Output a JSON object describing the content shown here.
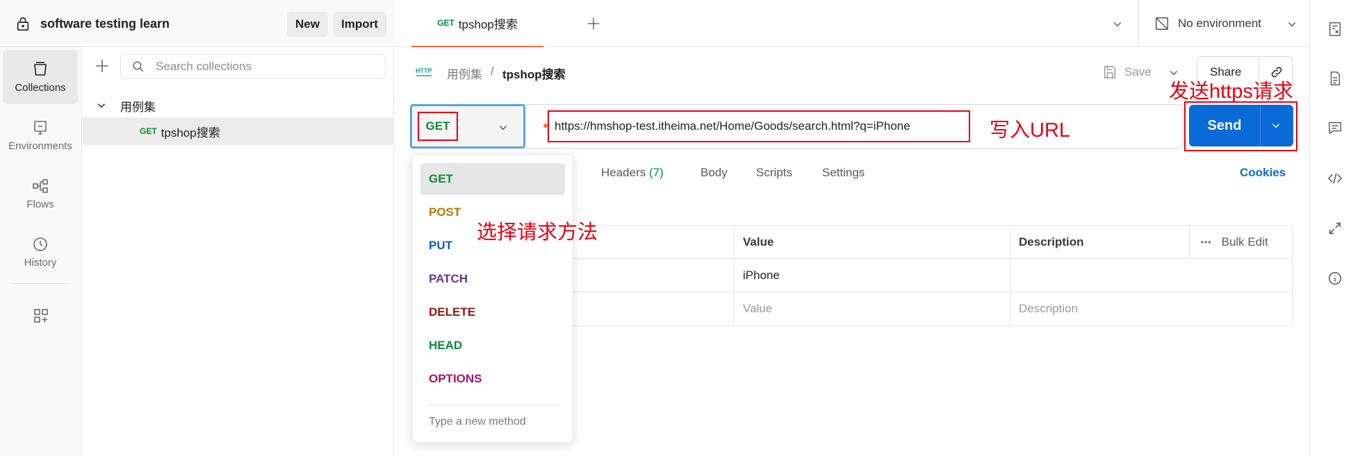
{
  "workspace": {
    "title": "software testing learn",
    "new_label": "New",
    "import_label": "Import"
  },
  "rail": {
    "items": [
      {
        "label": "Collections",
        "icon": "collections-icon",
        "active": true
      },
      {
        "label": "Environments",
        "icon": "environments-icon"
      },
      {
        "label": "Flows",
        "icon": "flows-icon"
      },
      {
        "label": "History",
        "icon": "history-icon"
      }
    ]
  },
  "sidebar": {
    "search_placeholder": "Search collections",
    "folder": "用例集",
    "request": {
      "method": "GET",
      "name": "tpshop搜索"
    }
  },
  "tabs": {
    "active": {
      "method": "GET",
      "name": "tpshop搜索"
    },
    "environment": "No environment"
  },
  "breadcrumb": {
    "parent": "用例集",
    "separator": "/",
    "current": "tpshop搜索"
  },
  "toolbar": {
    "save_label": "Save",
    "share_label": "Share"
  },
  "request": {
    "method": "GET",
    "url": "https://hmshop-test.itheima.net/Home/Goods/search.html?q=iPhone",
    "send_label": "Send"
  },
  "request_tabs": {
    "headers_label": "Headers",
    "headers_count": "(7)",
    "body_label": "Body",
    "scripts_label": "Scripts",
    "settings_label": "Settings",
    "cookies_label": "Cookies"
  },
  "params": {
    "headers": {
      "value": "Value",
      "description": "Description",
      "bulk_edit": "Bulk Edit"
    },
    "rows": [
      {
        "value": "iPhone",
        "description": ""
      }
    ],
    "placeholder": {
      "value": "Value",
      "description": "Description"
    }
  },
  "method_dropdown": {
    "options": [
      {
        "label": "GET",
        "color": "#0b8a3a",
        "selected": true
      },
      {
        "label": "POST",
        "color": "#ad7a03"
      },
      {
        "label": "PUT",
        "color": "#0a5fb5"
      },
      {
        "label": "PATCH",
        "color": "#623497"
      },
      {
        "label": "DELETE",
        "color": "#8e1a10"
      },
      {
        "label": "HEAD",
        "color": "#0b8a3a"
      },
      {
        "label": "OPTIONS",
        "color": "#a61468"
      }
    ],
    "new_method_placeholder": "Type a new method"
  },
  "annotations": {
    "url": "写入URL",
    "send": "发送https请求",
    "method": "选择请求方法"
  },
  "colors": {
    "accent": "#0a6bd8",
    "annotation": "#e60012",
    "get": "#0b8a3a",
    "tab_indicator": "#ff6c37"
  }
}
